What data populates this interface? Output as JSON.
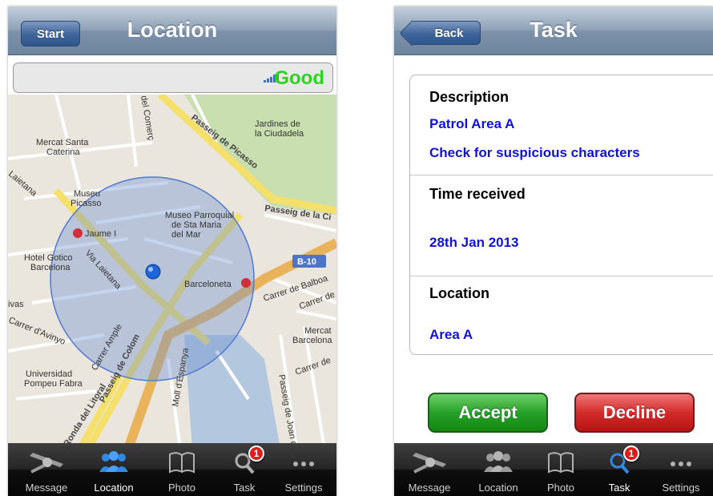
{
  "location_screen": {
    "title": "Location",
    "start_label": "Start",
    "signal_text": "Good",
    "map_labels": {
      "jardines": "Jardines de",
      "jardines2": "la Ciudadela",
      "mercat1": "Mercat Santa",
      "mercat2": "Caterina",
      "picasso_road": "Passeig de Picasso",
      "passeig_ci": "Passeig de la Ci",
      "museu1": "Museu",
      "museu2": "Picasso",
      "parroquial1": "Museo Parroquial",
      "parroquial2": "de Sta Maria",
      "parroquial3": "del Mar",
      "jaume": "Jaume I",
      "hotel1": "Hotel Gotico",
      "hotel2": "Barcelona",
      "via_laietana": "Via Laietana",
      "barceloneta": "Barceloneta",
      "b10": "B-10",
      "balboa": "Carrer de Balboa",
      "carrer_de": "Carrer de",
      "avinyo": "Carrer d'Avinyo",
      "ample": "Carrer Ample",
      "colom": "Passeig de Colom",
      "espanya": "Moll d'Espanya",
      "universidad1": "Universidad",
      "universidad2": "Pompeu Fabra",
      "litoral": "Ronda del Litoral",
      "mercat_r": "Mercat",
      "barcelona_r": "Barcelona",
      "comerc": "del Comerç",
      "laietana_l": "Laietana",
      "ivas": "ivas",
      "joan": "Passeig de Joan de",
      "carrer_r": "Carrer de"
    }
  },
  "task_screen": {
    "title": "Task",
    "back_label": "Back",
    "description_label": "Description",
    "description_line1": "Patrol Area A",
    "description_line2": "Check for suspicious characters",
    "time_label": "Time received",
    "time_value": "28th Jan 2013",
    "location_label": "Location",
    "location_value": "Area A",
    "accept_label": "Accept",
    "decline_label": "Decline"
  },
  "tabbar": {
    "tabs": [
      {
        "label": "Message",
        "icon": "satellite-icon"
      },
      {
        "label": "Location",
        "icon": "people-icon"
      },
      {
        "label": "Photo",
        "icon": "book-icon"
      },
      {
        "label": "Task",
        "icon": "magnifier-icon",
        "badge": "1"
      },
      {
        "label": "Settings",
        "icon": "more-dots-icon"
      }
    ],
    "left_selected": "Location"
  },
  "colors": {
    "signal_good": "#2bd51f",
    "task_value_blue": "#0f13d7",
    "accept_green": "#27a12a",
    "decline_red": "#d42b2b",
    "badge_red": "#e21a1a"
  }
}
